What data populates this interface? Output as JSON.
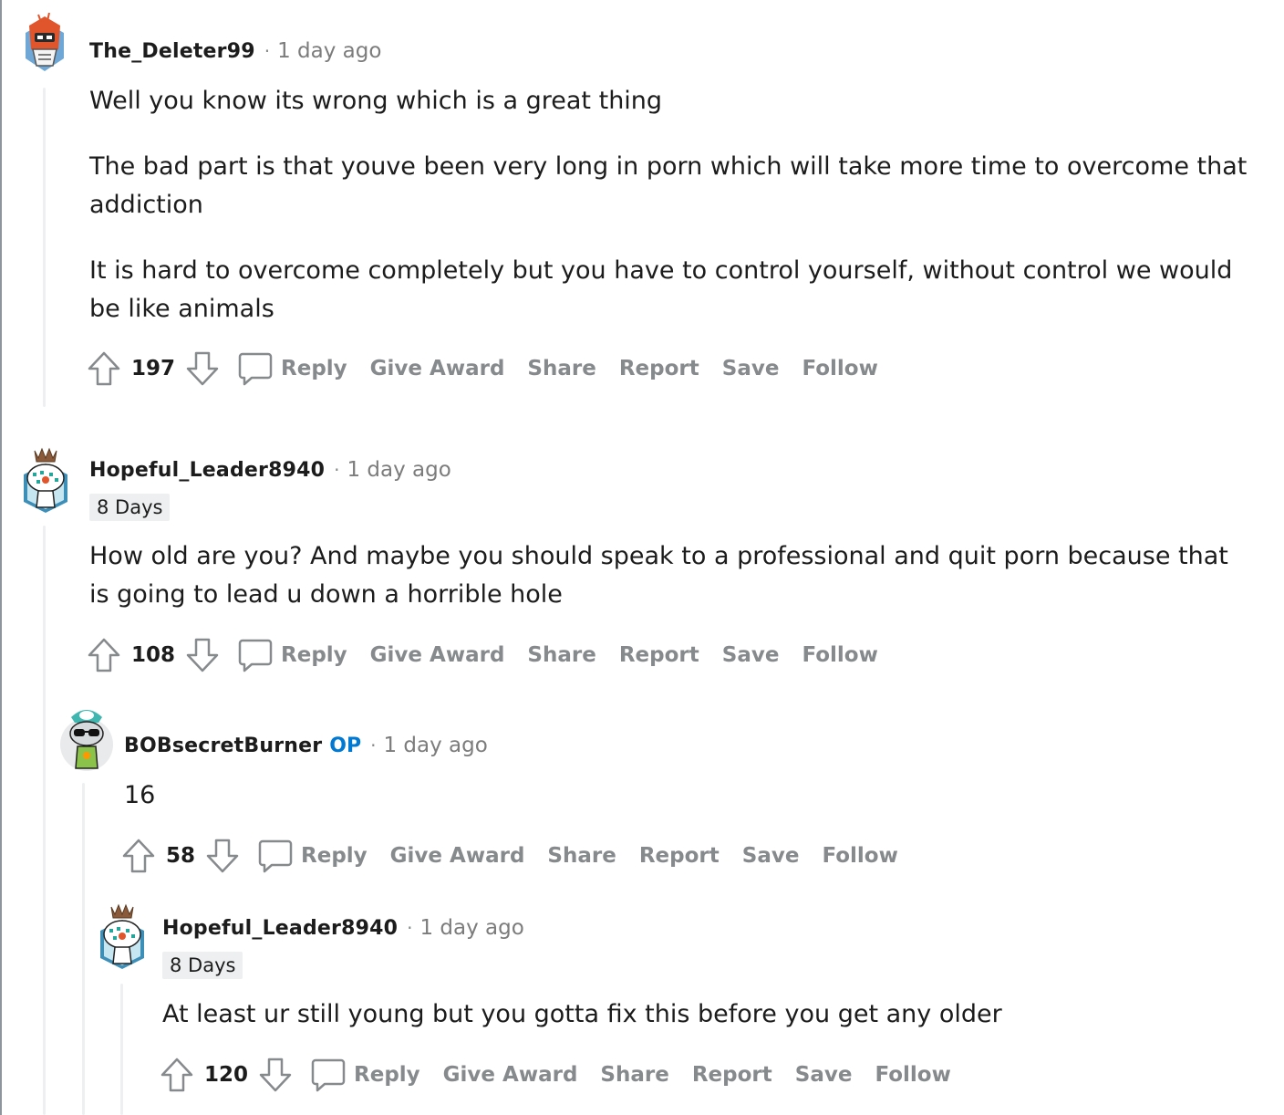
{
  "ui": {
    "op_badge": "OP",
    "separator": "·",
    "actions": {
      "reply": "Reply",
      "give_award": "Give Award",
      "share": "Share",
      "report": "Report",
      "save": "Save",
      "follow": "Follow"
    },
    "colors": {
      "accent": "#0079d3",
      "muted": "#878a8c",
      "thread_line": "#edeff1"
    }
  },
  "comments": [
    {
      "username": "The_Deleter99",
      "timestamp": "1 day ago",
      "avatar_icon": "robot-avatar-icon",
      "paragraphs": [
        "Well you know its wrong which is a great thing",
        "The bad part is that youve been very long in porn which will take more time to overcome that addiction",
        "It is hard to overcome completely but you have to control yourself, without control we would be like animals"
      ],
      "score": "197"
    },
    {
      "username": "Hopeful_Leader8940",
      "timestamp": "1 day ago",
      "flair": "8 Days",
      "avatar_icon": "snoo-avatar-icon",
      "paragraphs": [
        "How old are you? And maybe you should speak to a professional and quit porn because that is going to lead u down a horrible hole"
      ],
      "score": "108"
    },
    {
      "username": "BOBsecretBurner",
      "is_op": true,
      "timestamp": "1 day ago",
      "avatar_icon": "sunglasses-snoo-avatar-icon",
      "paragraphs": [
        "16"
      ],
      "score": "58"
    },
    {
      "username": "Hopeful_Leader8940",
      "timestamp": "1 day ago",
      "flair": "8 Days",
      "avatar_icon": "snoo-avatar-icon",
      "paragraphs": [
        "At least ur still young but you gotta fix this before you get any older"
      ],
      "score": "120"
    }
  ]
}
